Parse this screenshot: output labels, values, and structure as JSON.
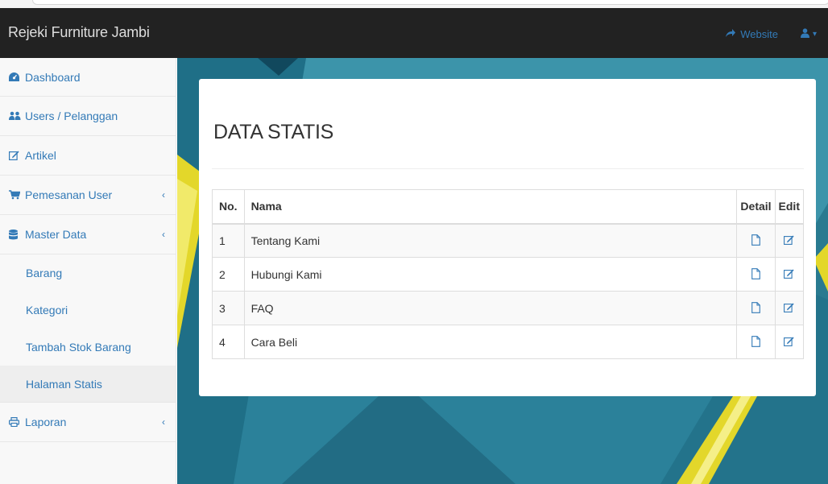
{
  "app": {
    "brand": "Rejeki Furniture Jambi"
  },
  "navbar": {
    "website_label": "Website",
    "user_caret": "▾"
  },
  "sidebar": {
    "items": [
      {
        "label": "Dashboard"
      },
      {
        "label": "Users / Pelanggan"
      },
      {
        "label": "Artikel"
      },
      {
        "label": "Pemesanan User",
        "chevron": "‹"
      },
      {
        "label": "Master Data",
        "chevron": "‹"
      }
    ],
    "sub_items": [
      {
        "label": "Barang"
      },
      {
        "label": "Kategori"
      },
      {
        "label": "Tambah Stok Barang"
      },
      {
        "label": "Halaman Statis"
      }
    ],
    "laporan": {
      "label": "Laporan",
      "chevron": "‹"
    }
  },
  "main": {
    "title": "DATA STATIS",
    "table": {
      "headers": [
        "No.",
        "Nama",
        "Detail",
        "Edit"
      ],
      "rows": [
        {
          "no": "1",
          "nama": "Tentang Kami"
        },
        {
          "no": "2",
          "nama": "Hubungi Kami"
        },
        {
          "no": "3",
          "nama": "FAQ"
        },
        {
          "no": "4",
          "nama": "Cara Beli"
        }
      ]
    }
  },
  "colors": {
    "link": "#337ab7",
    "navbar": "#222222",
    "accent_yellow": "#e3d72a",
    "teal": "#2b7e96"
  }
}
